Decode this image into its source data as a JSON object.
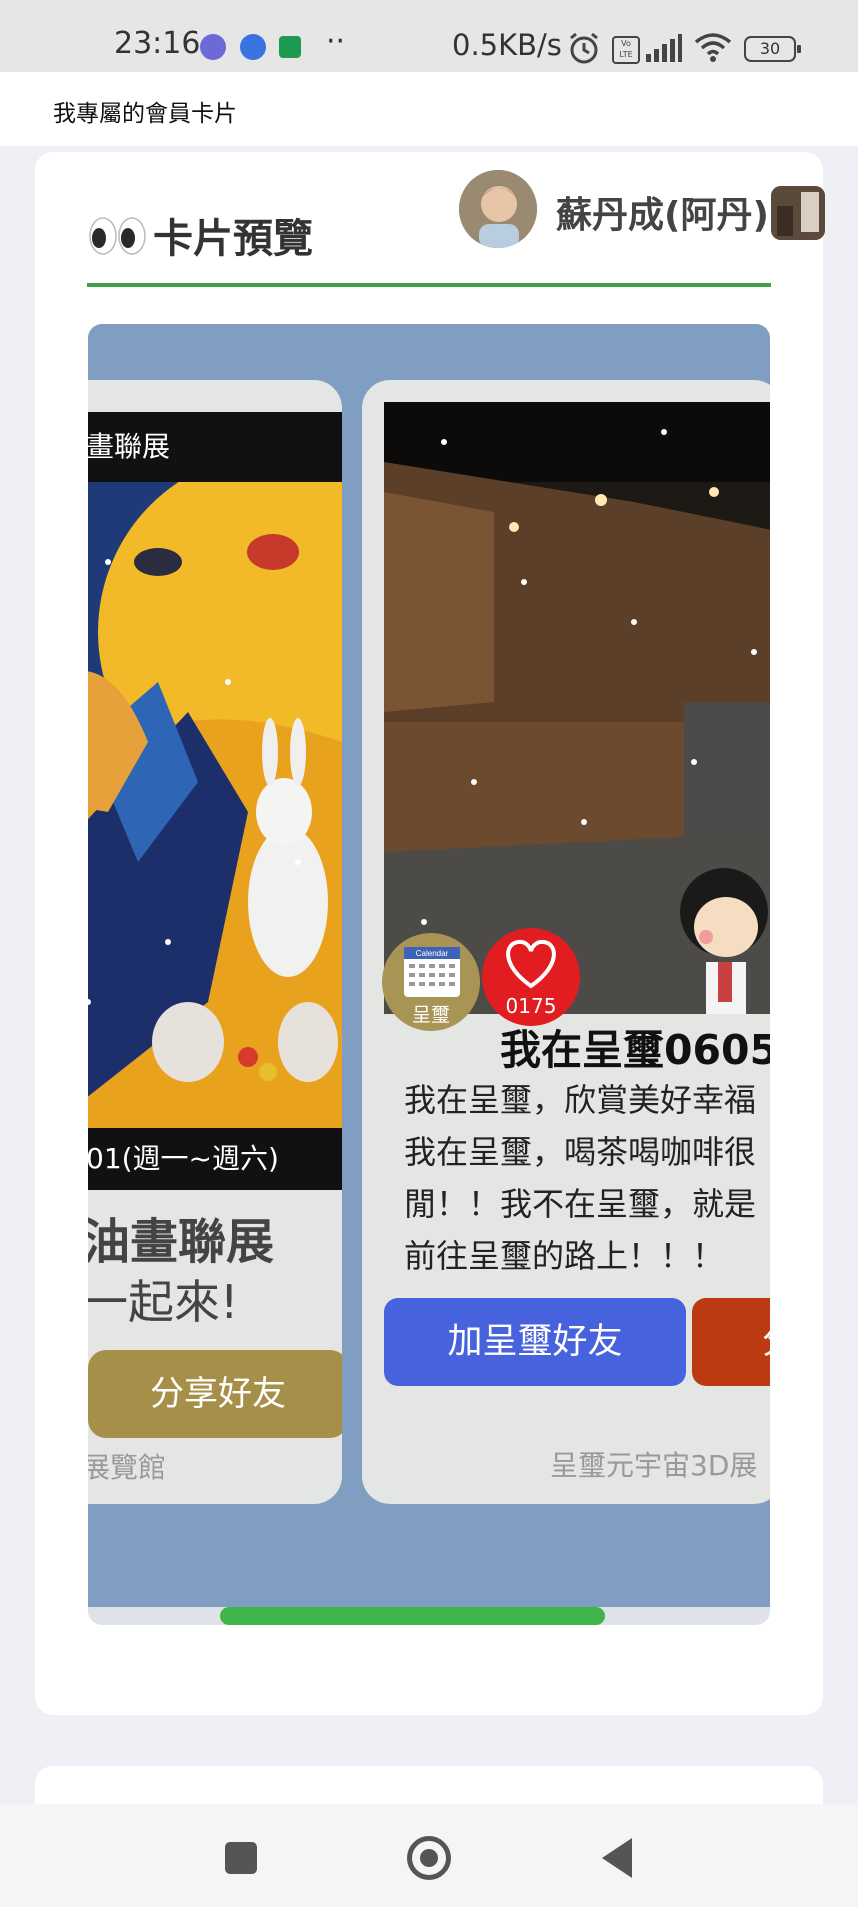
{
  "status_bar": {
    "time": "23:16",
    "network_speed": "0.5KB/s",
    "battery": "30",
    "overflow_dots": "··",
    "volte_label": "Vo LTE"
  },
  "header": {
    "title": "我專屬的會員卡片"
  },
  "preview": {
    "title": "卡片預覽",
    "user_name": "蘇丹成(阿丹)"
  },
  "card_left": {
    "banner": "畫聯展",
    "date": "01(週一~週六)",
    "line1": "油畫聯展",
    "line2": "一起來!",
    "share_button": "分享好友",
    "footer": "展覽館"
  },
  "card_right": {
    "calendar_label": "Calendar",
    "calendar_name": "呈璽",
    "like_count": "0175",
    "title": "我在呈璽0605",
    "description": [
      "我在呈璽，欣賞美好幸福",
      "我在呈璽，喝茶喝咖啡很",
      "閒！！我不在呈璽，就是",
      "前往呈璽的路上！！！"
    ],
    "add_friend_button": "加呈璽好友",
    "share_button": "分",
    "footer": "呈璽元宇宙3D展"
  },
  "colors": {
    "accent_green": "#43a047",
    "carousel_bg": "#7f9ec2",
    "add_friend_blue": "#4762dd",
    "share_gold": "#a69049",
    "share_red": "#bc3a12",
    "heart_red": "#e11d22"
  }
}
